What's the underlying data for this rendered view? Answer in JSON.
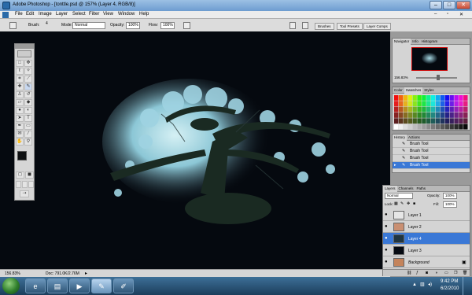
{
  "window": {
    "title": "Adobe Photoshop - [tonttle.psd @ 157% (Layer 4, RGB/8)]"
  },
  "menu": [
    "File",
    "Edit",
    "Image",
    "Layer",
    "Select",
    "Filter",
    "View",
    "Window",
    "Help"
  ],
  "options": {
    "brush_label": "Brush:",
    "brush_size": "4",
    "mode_label": "Mode:",
    "mode_value": "Normal",
    "opacity_label": "Opacity:",
    "opacity_value": "100%",
    "flow_label": "Flow:",
    "flow_value": "100%",
    "panel_tabs": [
      "Brushes",
      "Tool Presets",
      "Layer Comps"
    ]
  },
  "status": {
    "zoom": "156.83%",
    "doc": "Doc: 791.0K/2.76M"
  },
  "navigator": {
    "tabs": [
      "Navigator",
      "Info",
      "Histogram"
    ],
    "zoom": "156.83%"
  },
  "color": {
    "tabs": [
      "Color",
      "Swatches",
      "Styles"
    ]
  },
  "history": {
    "tabs": [
      "History",
      "Actions"
    ],
    "items": [
      {
        "label": "Brush Tool"
      },
      {
        "label": "Brush Tool"
      },
      {
        "label": "Brush Tool"
      },
      {
        "label": "Brush Tool"
      }
    ]
  },
  "layers": {
    "tabs": [
      "Layers",
      "Channels",
      "Paths"
    ],
    "mode": "Normal",
    "opacity_label": "Opacity:",
    "opacity_value": "100%",
    "lock_label": "Lock:",
    "fill_label": "Fill:",
    "fill_value": "100%",
    "items": [
      {
        "name": "Layer 1",
        "selected": false,
        "color": "#e6e6e6"
      },
      {
        "name": "Layer 2",
        "selected": false,
        "color": "#c98f72"
      },
      {
        "name": "Layer 4",
        "selected": true,
        "color": "#203540"
      },
      {
        "name": "Layer 3",
        "selected": false,
        "color": "#060a12"
      },
      {
        "name": "Background",
        "selected": false,
        "color": "#c4845c"
      }
    ]
  },
  "taskbar": {
    "time": "9:42 PM",
    "date": "6/2/2010"
  }
}
